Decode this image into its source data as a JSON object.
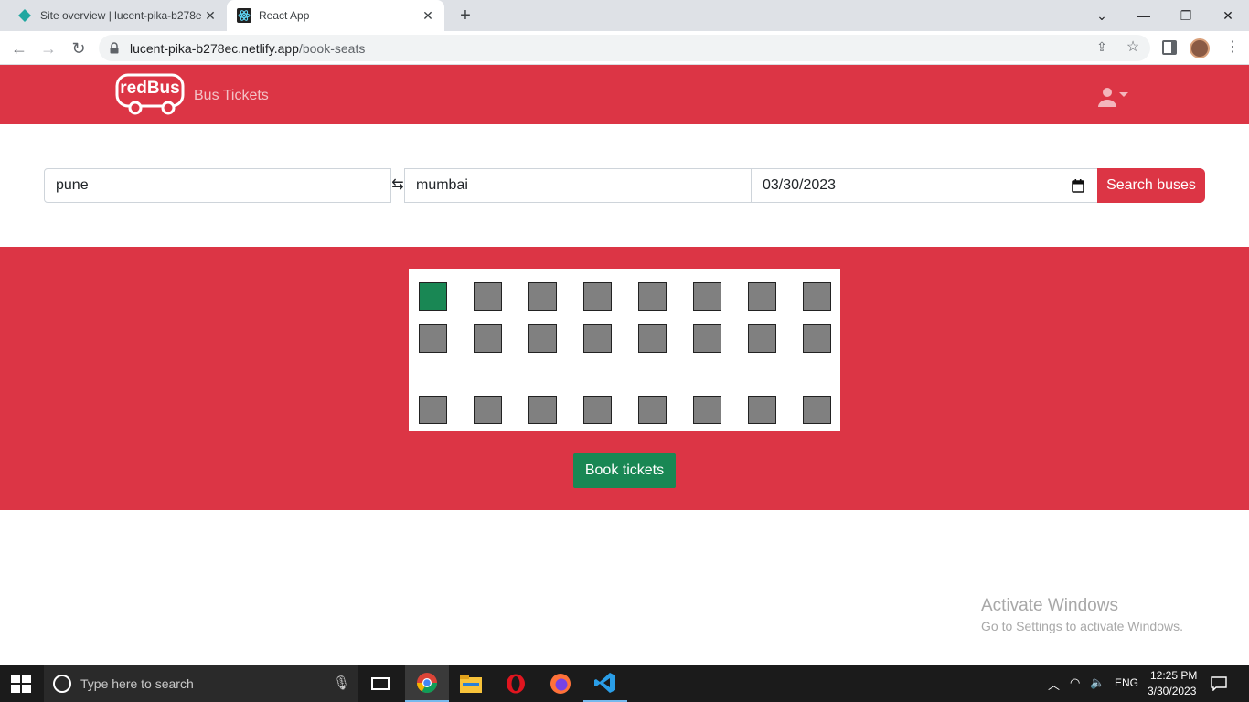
{
  "browser": {
    "tabs": [
      {
        "title": "Site overview | lucent-pika-b278e"
      },
      {
        "title": "React App"
      }
    ],
    "url_host": "lucent-pika-b278ec.netlify.app",
    "url_path": "/book-seats"
  },
  "header": {
    "logo_text": "redBus",
    "brand_label": "Bus Tickets"
  },
  "search": {
    "from_value": "pune",
    "to_value": "mumbai",
    "date_value": "03/30/2023",
    "button_label": "Search buses"
  },
  "seats": {
    "rows": [
      [
        "selected",
        "available",
        "available",
        "available",
        "available",
        "available",
        "available",
        "available"
      ],
      [
        "available",
        "available",
        "available",
        "available",
        "available",
        "available",
        "available",
        "available"
      ],
      [
        "available",
        "available",
        "available",
        "available",
        "available",
        "available",
        "available",
        "available"
      ]
    ],
    "book_label": "Book tickets"
  },
  "watermark": {
    "title": "Activate Windows",
    "subtitle": "Go to Settings to activate Windows."
  },
  "taskbar": {
    "search_placeholder": "Type here to search",
    "language": "ENG",
    "time": "12:25 PM",
    "date": "3/30/2023"
  },
  "colors": {
    "brand_red": "#dc3545",
    "seat_available": "#808080",
    "seat_selected": "#198754",
    "book_green": "#198754"
  }
}
